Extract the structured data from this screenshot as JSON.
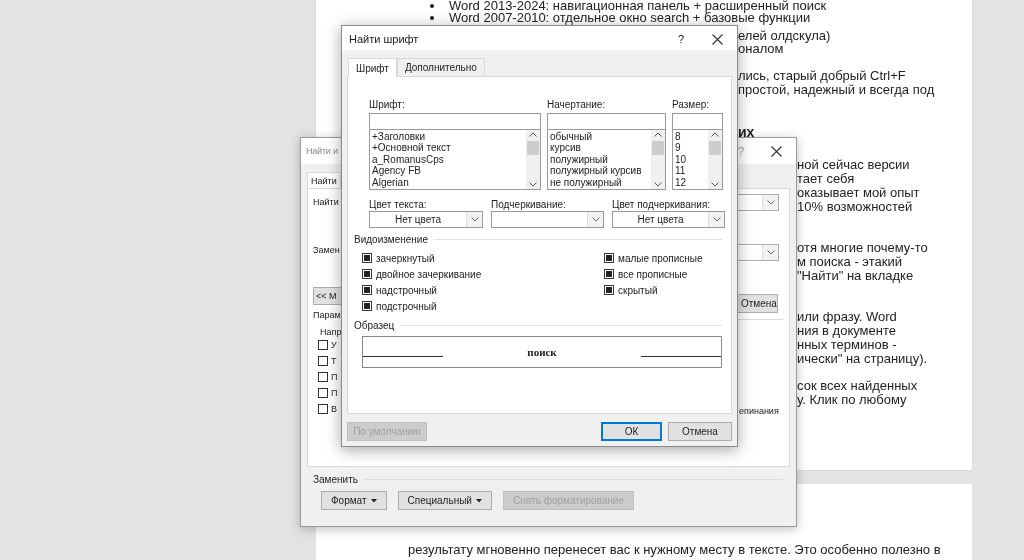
{
  "document": {
    "top_lines": [
      "Word 2013-2024: навигационная панель + расширенный поиск",
      "Word 2007-2010: отдельное окно search + базовые функции"
    ],
    "right_fragments": [
      {
        "text": "елей олдскула)",
        "bold": false
      },
      {
        "text": "оналом",
        "bold": false
      },
      {
        "text": "лись, старый добрый Ctrl+F",
        "bold": false
      },
      {
        "text": "простой, надежный и всегда под",
        "bold": false
      },
      {
        "text": "их",
        "bold": true
      },
      {
        "text": "ной сейчас версии",
        "bold": false
      },
      {
        "text": "тает себя",
        "bold": false
      },
      {
        "text": "оказывает мой опыт",
        "bold": false
      },
      {
        "text": "10% возможностей",
        "bold": false
      },
      {
        "text": "отя многие почему-то",
        "bold": false
      },
      {
        "text": "м поиска - этакий",
        "bold": false
      },
      {
        "text": "\"Найти\" на вкладке",
        "bold": false
      },
      {
        "text": "или фразу. Word",
        "bold": false
      },
      {
        "text": "ния в документе",
        "bold": false
      },
      {
        "text": "нных терминов -",
        "bold": false
      },
      {
        "text": "ически\" на страницу).",
        "bold": false
      },
      {
        "text": "сок всех найденных",
        "bold": false
      },
      {
        "text": "у. Клик по любому",
        "bold": false
      }
    ],
    "bottom_line": "результату мгновенно перенесет вас к нужному месту в тексте. Это особенно полезно в"
  },
  "find_replace_dialog": {
    "title": "Найти и",
    "help": "?",
    "tab": "Найти",
    "find_label": "Найти",
    "replace_label": "Замен",
    "more_button": "<< М",
    "options_label": "Парам",
    "direction_label": "Напр",
    "checkboxes": [
      {
        "label": "У",
        "checked": false
      },
      {
        "label": "Т",
        "checked": false
      },
      {
        "label": "П",
        "checked": false
      },
      {
        "label": "П",
        "checked": false
      },
      {
        "label": "В",
        "checked": false
      }
    ],
    "cancel_button": "Отмена",
    "right_fragment": "епинания",
    "replace_section": "Заменить",
    "buttons": [
      {
        "label": "Формат",
        "dropdown": true,
        "disabled": false
      },
      {
        "label": "Специальный",
        "dropdown": true,
        "disabled": false
      },
      {
        "label": "Снять форматирование",
        "dropdown": false,
        "disabled": true
      }
    ]
  },
  "font_dialog": {
    "title": "Найти шрифт",
    "help": "?",
    "tabs": [
      {
        "label": "Шрифт",
        "selected": true
      },
      {
        "label": "Дополнительно",
        "selected": false
      }
    ],
    "lists": [
      {
        "label": "Шрифт:",
        "items": [
          "+Заголовки",
          "+Основной текст",
          "a_RomanusCps",
          "Agency FB",
          "Algerian"
        ]
      },
      {
        "label": "Начертание:",
        "items": [
          "обычный",
          "курсив",
          "полужирный",
          "полужирный курсив",
          "не полужирный"
        ]
      },
      {
        "label": "Размер:",
        "items": [
          "8",
          "9",
          "10",
          "11",
          "12"
        ]
      }
    ],
    "dropdowns": [
      {
        "label": "Цвет текста:",
        "value": "Нет цвета"
      },
      {
        "label": "Подчеркивание:"
      },
      {
        "label": "Цвет подчеркивания:",
        "value": "Нет цвета"
      }
    ],
    "effects_title": "Видоизменение",
    "effects_left": [
      {
        "label": "зачеркнутый",
        "indeterminate": true
      },
      {
        "label": "двойное зачеркивание",
        "indeterminate": true
      },
      {
        "label": "надстрочный",
        "indeterminate": true
      },
      {
        "label": "подстрочный",
        "indeterminate": true
      }
    ],
    "effects_right": [
      {
        "label": "малые прописные",
        "indeterminate": true
      },
      {
        "label": "все прописные",
        "indeterminate": true
      },
      {
        "label": "скрытый",
        "indeterminate": true
      }
    ],
    "preview_title": "Образец",
    "preview_sample": "поиск",
    "buttons": [
      {
        "label": "По умолчанию",
        "disabled": true,
        "default": false
      },
      {
        "label": "ОК",
        "disabled": false,
        "default": true
      },
      {
        "label": "Отмена",
        "disabled": false,
        "default": false
      }
    ]
  }
}
